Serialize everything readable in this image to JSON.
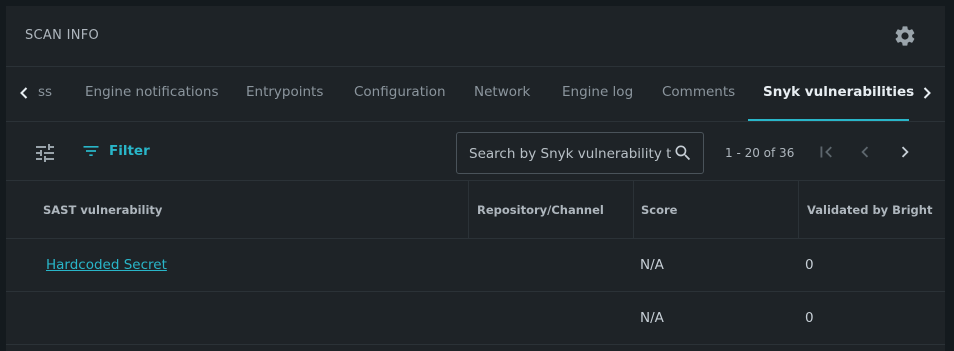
{
  "header": {
    "title": "SCAN INFO",
    "settings_icon": "gear-icon"
  },
  "tabs": [
    {
      "label": "ss",
      "active": false
    },
    {
      "label": "Engine notifications",
      "active": false
    },
    {
      "label": "Entrypoints",
      "active": false
    },
    {
      "label": "Configuration",
      "active": false
    },
    {
      "label": "Network",
      "active": false
    },
    {
      "label": "Engine log",
      "active": false
    },
    {
      "label": "Comments",
      "active": false
    },
    {
      "label": "Snyk vulnerabilities",
      "active": true
    }
  ],
  "toolbar": {
    "filter_label": "Filter",
    "search_placeholder": "Search by Snyk vulnerability title",
    "pagination_range": "1 - 20 of 36"
  },
  "table": {
    "columns": [
      "SAST vulnerability",
      "Repository/Channel",
      "Score",
      "Validated by Bright"
    ],
    "rows": [
      {
        "vulnerability": "Hardcoded Secret",
        "repository": "",
        "score": "N/A",
        "validated": "0"
      },
      {
        "vulnerability": "",
        "repository": "",
        "score": "N/A",
        "validated": "0"
      }
    ]
  },
  "colors": {
    "accent": "#29b6c9",
    "background": "#1e2327",
    "border": "#2b3237"
  }
}
